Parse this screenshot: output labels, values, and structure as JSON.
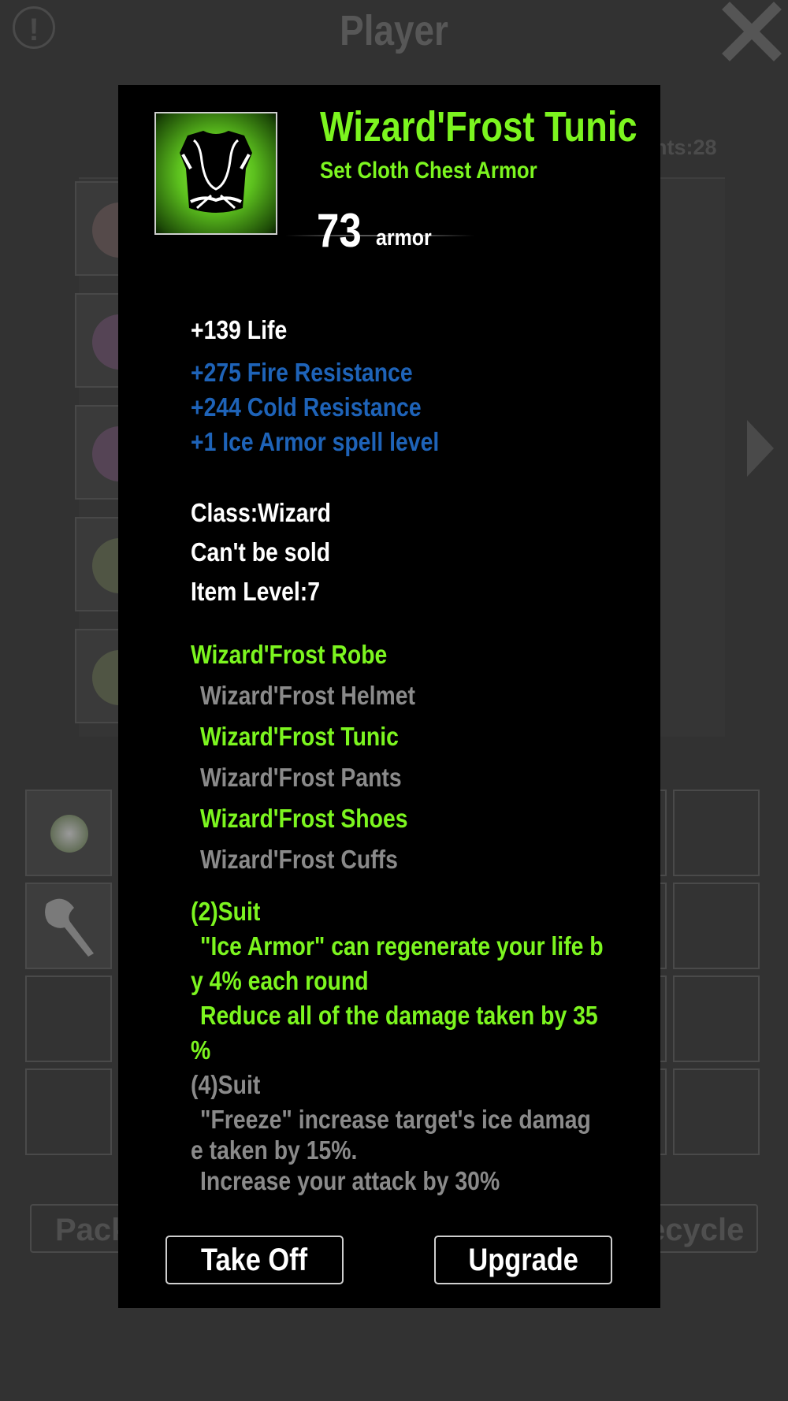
{
  "screen": {
    "title": "Player",
    "points_text": "nts:28",
    "side_arrow_icon": "chevron-right-icon",
    "bottom_left_button": "Pack",
    "bottom_right_button": "ecycle"
  },
  "tooltip": {
    "name": "Wizard'Frost Tunic",
    "type": "Set Cloth Chest Armor",
    "armor_value": "73",
    "armor_label": "armor",
    "base_stat": "+139 Life",
    "magic_stats": [
      "+275 Fire Resistance",
      "+244 Cold Resistance",
      "+1 Ice Armor spell level"
    ],
    "info": [
      "Class:Wizard",
      "Can't be sold",
      "Item Level:7"
    ],
    "set_name": "Wizard'Frost Robe",
    "set_items": [
      {
        "name": "Wizard'Frost Helmet",
        "owned": false
      },
      {
        "name": "Wizard'Frost Tunic",
        "owned": true
      },
      {
        "name": "Wizard'Frost Pants",
        "owned": false
      },
      {
        "name": "Wizard'Frost Shoes",
        "owned": true
      },
      {
        "name": "Wizard'Frost Cuffs",
        "owned": false
      }
    ],
    "suit2": {
      "title": "(2)Suit",
      "lines": [
        "\"Ice Armor\" can regenerate your life b",
        "y 4% each round",
        "Reduce all of the damage taken by 35",
        "%"
      ]
    },
    "suit4": {
      "title": "(4)Suit",
      "lines": [
        "\"Freeze\" increase target's ice damag",
        "e taken by 15%.",
        "Increase your attack by 30%"
      ]
    },
    "buttons": {
      "take_off": "Take Off",
      "upgrade": "Upgrade"
    }
  },
  "colors": {
    "set_green": "#7cf51f",
    "magic_blue": "#1e63b8",
    "inactive_gray": "#8a8a8a",
    "overlay_bg": "#000000"
  }
}
